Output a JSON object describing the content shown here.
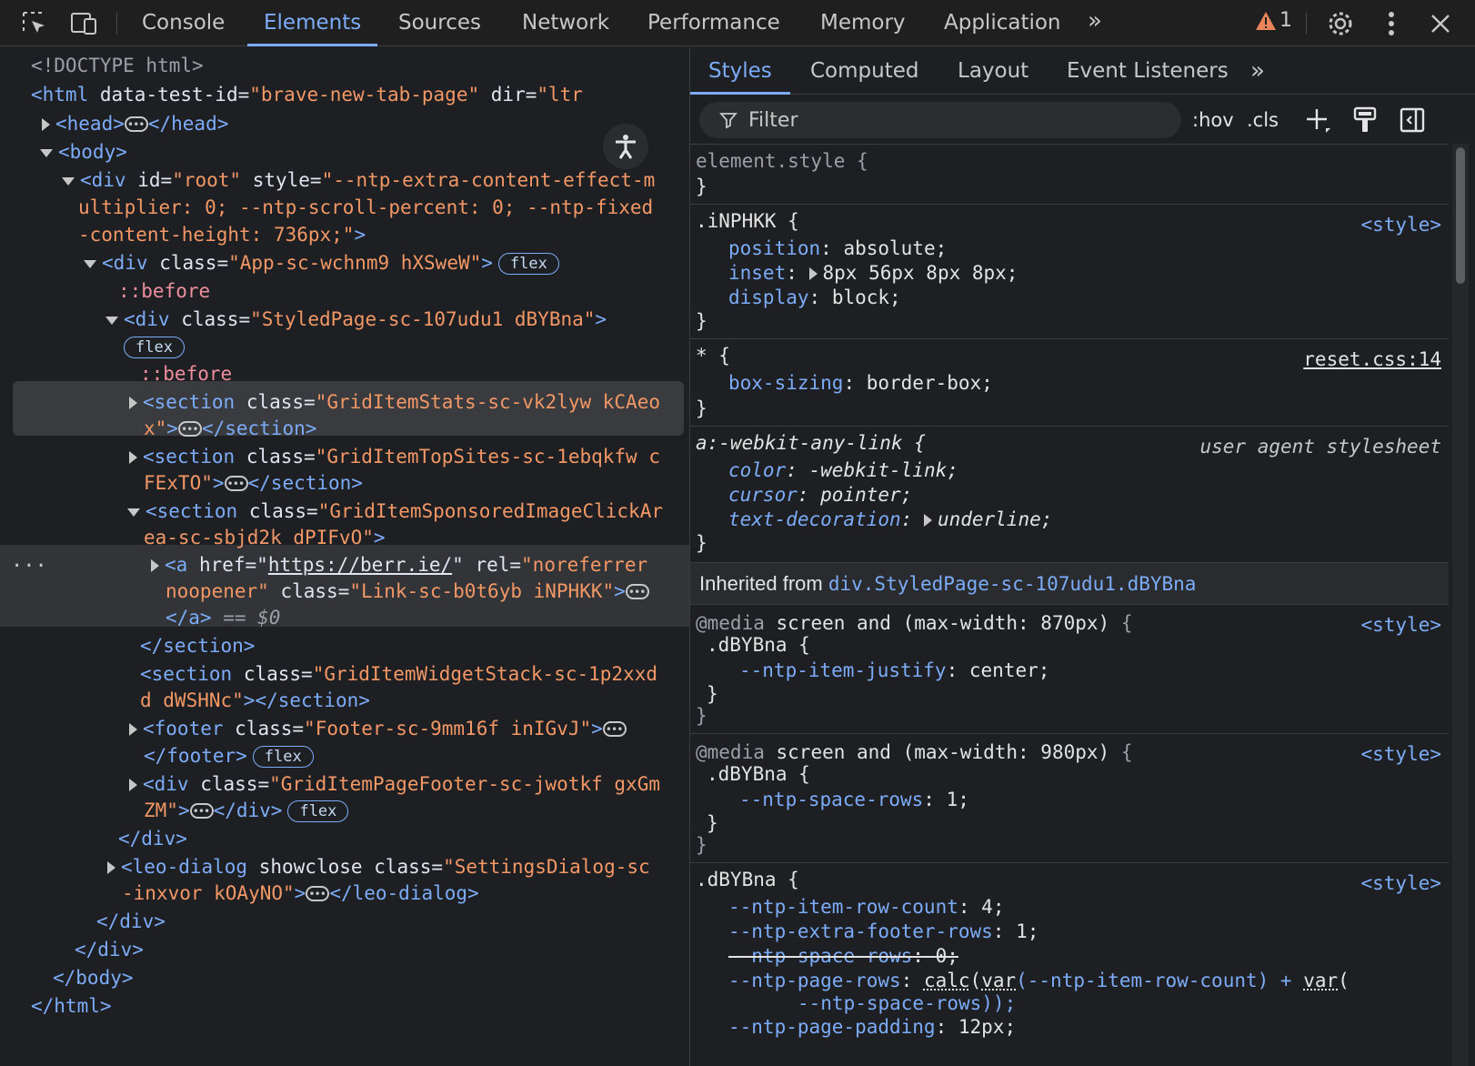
{
  "toolbar": {
    "tabs": [
      "Console",
      "Elements",
      "Sources",
      "Network",
      "Performance",
      "Memory",
      "Application"
    ],
    "active_tab": "Elements",
    "more_tabs": "»",
    "warning_count": "1"
  },
  "dom": {
    "doctype": "<!DOCTYPE html>",
    "html_open_tag": "<html",
    "html_attr1_name": "data-test-id",
    "html_attr1_value": "\"brave-new-tab-page\"",
    "html_attr2_name": "dir",
    "html_attr2_value": "\"ltr",
    "head_open": "<head>",
    "head_close": "</head>",
    "body_open": "<body>",
    "root_div": "<div",
    "root_id_name": "id",
    "root_id_value": "\"root\"",
    "root_style_name": "style",
    "root_style_line1": "\"--ntp-extra-content-effect-m",
    "root_style_line2": "ultiplier: 0; --ntp-scroll-percent: 0; --ntp-fixed",
    "root_style_line3": "-content-height: 736px;\"",
    "gt": ">",
    "app_div_value": "\"App-sc-wchnm9 hXSweW\"",
    "badge_flex": "flex",
    "before": "::before",
    "styled_page_value": "\"StyledPage-sc-107udu1 dBYBna\"",
    "class_name": "class",
    "div_open": "<div",
    "div_close": "</div>",
    "section_open": "<section",
    "section_close": "</section>",
    "stats_value_l1": "\"GridItemStats-sc-vk2lyw kCAeo",
    "stats_value_l2": "x\"",
    "topsites_value_l1": "\"GridItemTopSites-sc-1ebqkfw c",
    "topsites_value_l2": "FExTO\"",
    "sponsored_value_l1": "\"GridItemSponsoredImageClickAr",
    "sponsored_value_l2": "ea-sc-sbjd2k dPIFvO\"",
    "a_open": "<a",
    "href_name": "href",
    "href_value": "https://berr.ie/",
    "rel_name": "rel",
    "rel_value_l1": "\"noreferrer",
    "rel_value_l2": "noopener\"",
    "a_class_value": "\"Link-sc-b0t6yb iNPHKK\"",
    "a_close": "</a>",
    "selected_marker": "== $0",
    "widget_value_l1": "\"GridItemWidgetStack-sc-1p2xxd",
    "widget_value_l2": "d dWSHNc\"",
    "footer_open": "<footer",
    "footer_value": "\"Footer-sc-9mm16f inIGvJ\"",
    "footer_close": "</footer>",
    "pagefooter_value_l1": "\"GridItemPageFooter-sc-jwotkf gxGm",
    "pagefooter_value_l2": "ZM\"",
    "leo_open": "<leo-dialog",
    "leo_attr": "showclose",
    "leo_value_l1": "\"SettingsDialog-sc",
    "leo_value_l2": "-inxvor kOAyNO\"",
    "leo_close": "</leo-dialog>",
    "body_close": "</body>",
    "html_close": "</html>",
    "row_menu": "..."
  },
  "styles": {
    "subtabs": [
      "Styles",
      "Computed",
      "Layout",
      "Event Listeners"
    ],
    "active_subtab": "Styles",
    "more_subtabs": "»",
    "filter_placeholder": "Filter",
    "hov": ":hov",
    "cls": ".cls",
    "element_style": "element.style {",
    "close_brace": "}",
    "r1_selector": ".iNPHKK {",
    "r1_source": "<style>",
    "r1_p1": "position",
    "r1_v1": "absolute;",
    "r1_p2": "inset",
    "r1_v2": "8px 56px 8px 8px;",
    "r1_p3": "display",
    "r1_v3": "block;",
    "r2_selector": "* {",
    "r2_source": "reset.css:14",
    "r2_p1": "box-sizing",
    "r2_v1": "border-box;",
    "r3_selector": "a:-webkit-any-link {",
    "r3_source": "user agent stylesheet",
    "r3_p1": "color",
    "r3_v1": "-webkit-link;",
    "r3_p2": "cursor",
    "r3_v2": "pointer;",
    "r3_p3": "text-decoration",
    "r3_v3": "underline;",
    "inherited_label": "Inherited from",
    "inherited_link": "div.StyledPage-sc-107udu1.dBYBna",
    "m1_at": "@media",
    "m1_query": "screen and (max-width: 870px)",
    "m1_source": "<style>",
    "m1_selector": ".dBYBna {",
    "m1_p1": "--ntp-item-justify",
    "m1_v1": "center;",
    "m2_at": "@media",
    "m2_query": "screen and (max-width: 980px)",
    "m2_source": "<style>",
    "m2_selector": ".dBYBna {",
    "m2_p1": "--ntp-space-rows",
    "m2_v1": "1;",
    "r4_selector": ".dBYBna {",
    "r4_source": "<style>",
    "r4_p1": "--ntp-item-row-count",
    "r4_v1": "4;",
    "r4_p2": "--ntp-extra-footer-rows",
    "r4_v2": "1;",
    "r4_p3": "--ntp-space-rows",
    "r4_v3": "0;",
    "r4_p4": "--ntp-page-rows",
    "r4_v4_calc": "calc",
    "r4_v4_var1": "var",
    "r4_v4_arg1": "(--ntp-item-row-count) + ",
    "r4_v4_var2": "var",
    "r4_v4_paren": "(",
    "r4_v4_line2": "--ntp-space-rows));",
    "r4_p5": "--ntp-page-padding",
    "r4_v5": "12px;"
  }
}
